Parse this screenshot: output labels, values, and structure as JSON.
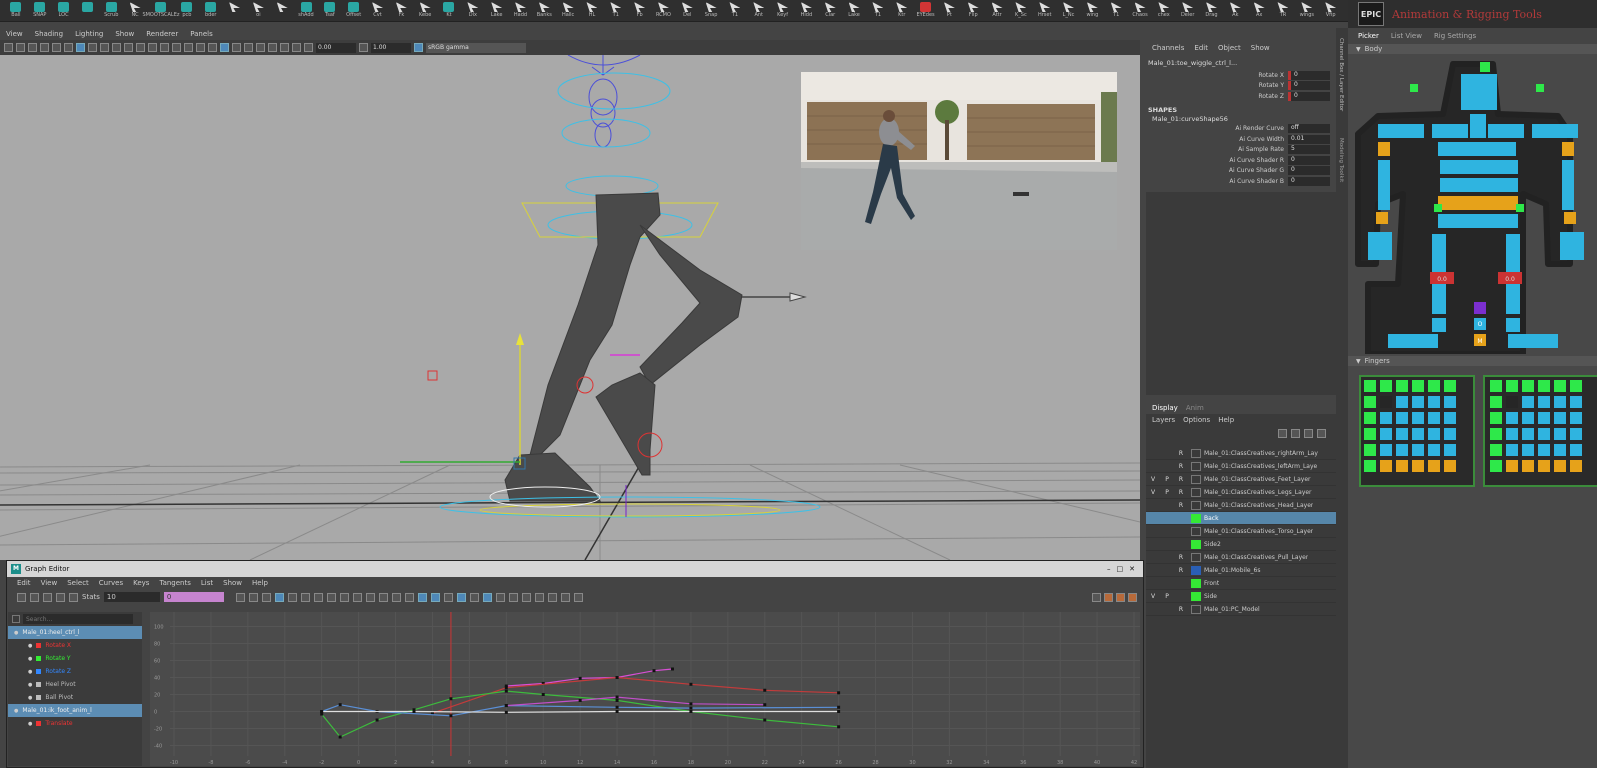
{
  "shelf": {
    "icons": [
      {
        "label": "Ball",
        "kind": "teal"
      },
      {
        "label": "SNAP",
        "kind": "teal"
      },
      {
        "label": "LOC",
        "kind": "teal"
      },
      {
        "label": "",
        "kind": "teal"
      },
      {
        "label": "Scrub",
        "kind": "teal"
      },
      {
        "label": "NC",
        "kind": "white"
      },
      {
        "label": "SMOOTSCALEz",
        "kind": "teal"
      },
      {
        "label": "pcb",
        "kind": "teal"
      },
      {
        "label": "bder",
        "kind": "teal"
      },
      {
        "label": "",
        "kind": "white"
      },
      {
        "label": "oi",
        "kind": "white"
      },
      {
        "label": "",
        "kind": "white"
      },
      {
        "label": "shAdd",
        "kind": "teal"
      },
      {
        "label": "Tsaf",
        "kind": "teal"
      },
      {
        "label": "Offset",
        "kind": "teal"
      },
      {
        "label": "Cvt",
        "kind": "white"
      },
      {
        "label": "Fk",
        "kind": "white"
      },
      {
        "label": "Kebe",
        "kind": "white"
      },
      {
        "label": "Kt",
        "kind": "teal"
      },
      {
        "label": "Dlx",
        "kind": "white"
      },
      {
        "label": "Lake",
        "kind": "white"
      },
      {
        "label": "Hadd",
        "kind": "white"
      },
      {
        "label": "Banks",
        "kind": "white"
      },
      {
        "label": "Hallc",
        "kind": "white"
      },
      {
        "label": "HL",
        "kind": "white"
      },
      {
        "label": "T1",
        "kind": "white"
      },
      {
        "label": "Fb",
        "kind": "white"
      },
      {
        "label": "RCMO",
        "kind": "white"
      },
      {
        "label": "Del",
        "kind": "white"
      },
      {
        "label": "Snap",
        "kind": "white"
      },
      {
        "label": "T1",
        "kind": "white"
      },
      {
        "label": "Ant",
        "kind": "white"
      },
      {
        "label": "Keyf",
        "kind": "white"
      },
      {
        "label": "Hldd",
        "kind": "white"
      },
      {
        "label": "Clar",
        "kind": "white"
      },
      {
        "label": "Lake",
        "kind": "white"
      },
      {
        "label": "T1",
        "kind": "white"
      },
      {
        "label": "Ktr",
        "kind": "white"
      },
      {
        "label": "EYEdes",
        "kind": "red"
      },
      {
        "label": "Pt",
        "kind": "white"
      },
      {
        "label": "Flip",
        "kind": "white"
      },
      {
        "label": "Attr",
        "kind": "white"
      },
      {
        "label": "K_Sc",
        "kind": "white"
      },
      {
        "label": "Hrset",
        "kind": "white"
      },
      {
        "label": "L_Nc",
        "kind": "white"
      },
      {
        "label": "wing",
        "kind": "white"
      },
      {
        "label": "T1",
        "kind": "white"
      },
      {
        "label": "Chaos",
        "kind": "white"
      },
      {
        "label": "chex",
        "kind": "white"
      },
      {
        "label": "Deler",
        "kind": "white"
      },
      {
        "label": "Drag",
        "kind": "white"
      },
      {
        "label": "Ak",
        "kind": "white"
      },
      {
        "label": "Ax",
        "kind": "white"
      },
      {
        "label": "TR",
        "kind": "white"
      },
      {
        "label": "wings",
        "kind": "white"
      },
      {
        "label": "Vfip",
        "kind": "white"
      },
      {
        "label": "",
        "kind": "white"
      }
    ]
  },
  "viewport": {
    "menu": [
      "View",
      "Shading",
      "Lighting",
      "Show",
      "Renderer",
      "Panels"
    ],
    "field_a": "0.00",
    "field_b": "1.00",
    "color_space": "sRGB gamma"
  },
  "channel_box": {
    "menu": [
      "Channels",
      "Edit",
      "Object",
      "Show"
    ],
    "node": "Male_01:toe_wiggle_ctrl_l...",
    "attrs": [
      {
        "label": "Rotate X",
        "value": "0"
      },
      {
        "label": "Rotate Y",
        "value": "0"
      },
      {
        "label": "Rotate Z",
        "value": "0"
      }
    ],
    "shapes_header": "SHAPES",
    "shape_node": "Male_01:curveShape56",
    "shape_attrs": [
      {
        "label": "Ai Render Curve",
        "value": "off"
      },
      {
        "label": "Ai Curve Width",
        "value": "0.01"
      },
      {
        "label": "Ai Sample Rate",
        "value": "5"
      },
      {
        "label": "Ai Curve Shader R",
        "value": "0"
      },
      {
        "label": "Ai Curve Shader G",
        "value": "0"
      },
      {
        "label": "Ai Curve Shader B",
        "value": "0"
      }
    ]
  },
  "layer_editor": {
    "tabs": [
      "Display",
      "Anim"
    ],
    "menu": [
      "Layers",
      "Options",
      "Help"
    ],
    "layers": [
      {
        "v": "",
        "p": "",
        "r": "R",
        "color": "",
        "name": "Male_01:ClassCreatives_rightArm_Lay",
        "sel": false
      },
      {
        "v": "",
        "p": "",
        "r": "R",
        "color": "",
        "name": "Male_01:ClassCreatives_leftArm_Laye",
        "sel": false
      },
      {
        "v": "V",
        "p": "P",
        "r": "R",
        "color": "",
        "name": "Male_01:ClassCreatives_Feet_Layer",
        "sel": false
      },
      {
        "v": "V",
        "p": "P",
        "r": "R",
        "color": "",
        "name": "Male_01:ClassCreatives_Legs_Layer",
        "sel": false
      },
      {
        "v": "",
        "p": "",
        "r": "R",
        "color": "",
        "name": "Male_01:ClassCreatives_Head_Layer",
        "sel": false
      },
      {
        "v": "",
        "p": "",
        "r": "",
        "color": "#35e835",
        "name": "Back",
        "sel": true
      },
      {
        "v": "",
        "p": "",
        "r": "",
        "color": "",
        "name": "Male_01:ClassCreatives_Torso_Layer",
        "sel": false
      },
      {
        "v": "",
        "p": "",
        "r": "",
        "color": "#35e835",
        "name": "Side2",
        "sel": false
      },
      {
        "v": "",
        "p": "",
        "r": "R",
        "color": "",
        "name": "Male_01:ClassCreatives_Pull_Layer",
        "sel": false
      },
      {
        "v": "",
        "p": "",
        "r": "R",
        "color": "#2a5fb5",
        "name": "Male_01:Mobile_6s",
        "sel": false
      },
      {
        "v": "",
        "p": "",
        "r": "",
        "color": "#35e835",
        "name": "Front",
        "sel": false
      },
      {
        "v": "V",
        "p": "P",
        "r": "",
        "color": "#35e835",
        "name": "Side",
        "sel": false
      },
      {
        "v": "",
        "p": "",
        "r": "R",
        "color": "",
        "name": "Male_01:PC_Model",
        "sel": false
      }
    ]
  },
  "side_tabs": [
    "Channel Box / Layer Editor",
    "Modeling Toolkit"
  ],
  "picker": {
    "logo": "EPIC",
    "title": "Animation & Rigging Tools",
    "tabs": [
      "Picker",
      "List View",
      "Rig Settings"
    ],
    "body_section": "Body",
    "fingers_section": "Fingers",
    "colors": {
      "blue": "#2fb4e0",
      "green": "#2ee84a",
      "orange": "#e6a21a",
      "purple": "#7b2fd0",
      "red": "#c33",
      "dark": "#262626"
    },
    "labels": {
      "hip_l": "0.0",
      "hip_r": "0.0",
      "mid": "M",
      "o": "O"
    }
  },
  "graph_editor": {
    "title": "Graph Editor",
    "menu": [
      "Edit",
      "View",
      "Select",
      "Curves",
      "Keys",
      "Tangents",
      "List",
      "Show",
      "Help"
    ],
    "stats_label": "Stats",
    "stats_value": "10",
    "frame_value": "0",
    "search_placeholder": "Search...",
    "outliner": [
      {
        "label": "Male_01:heel_ctrl_l",
        "color": "",
        "sel": true,
        "indent": 0
      },
      {
        "label": "Rotate X",
        "color": "#e33",
        "sel": false,
        "indent": 1
      },
      {
        "label": "Rotate Y",
        "color": "#3e3",
        "sel": false,
        "indent": 1
      },
      {
        "label": "Rotate Z",
        "color": "#38f",
        "sel": false,
        "indent": 1
      },
      {
        "label": "Heel Pivot",
        "color": "#bbb",
        "sel": false,
        "indent": 1
      },
      {
        "label": "Ball Pivot",
        "color": "#bbb",
        "sel": false,
        "indent": 1
      },
      {
        "label": "Male_01:ik_foot_anim_l",
        "color": "",
        "sel": true,
        "indent": 0
      },
      {
        "label": "Translate",
        "color": "#e33",
        "sel": false,
        "indent": 1
      }
    ],
    "y_ticks": [
      "100",
      "80",
      "60",
      "40",
      "20",
      "0",
      "-20",
      "-40"
    ],
    "x_ticks": [
      "-10",
      "-8",
      "-6",
      "-4",
      "-2",
      "0",
      "2",
      "4",
      "6",
      "8",
      "10",
      "12",
      "14",
      "16",
      "18",
      "20",
      "22",
      "24",
      "26",
      "28",
      "30",
      "32",
      "34",
      "36",
      "38",
      "40",
      "42"
    ],
    "current_frame": 5,
    "curves": [
      {
        "name": "pink",
        "color": "#d94fd6",
        "points": [
          [
            8,
            30
          ],
          [
            10,
            33
          ],
          [
            12,
            39
          ],
          [
            14,
            40
          ],
          [
            16,
            48
          ],
          [
            17,
            50
          ]
        ]
      },
      {
        "name": "red",
        "color": "#c43b3b",
        "points": [
          [
            4,
            -2
          ],
          [
            8,
            28
          ],
          [
            14,
            40
          ],
          [
            18,
            32
          ],
          [
            22,
            25
          ],
          [
            26,
            22
          ]
        ]
      },
      {
        "name": "green",
        "color": "#3dbb3d",
        "points": [
          [
            -2,
            -3
          ],
          [
            -1,
            -30
          ],
          [
            1,
            -10
          ],
          [
            3,
            2
          ],
          [
            5,
            15
          ],
          [
            8,
            24
          ],
          [
            10,
            20
          ],
          [
            14,
            13
          ],
          [
            18,
            0
          ],
          [
            22,
            -10
          ],
          [
            26,
            -18
          ]
        ]
      },
      {
        "name": "blue",
        "color": "#5a8fd6",
        "points": [
          [
            -2,
            0
          ],
          [
            -1,
            8
          ],
          [
            1,
            0
          ],
          [
            5,
            -5
          ],
          [
            8,
            7
          ],
          [
            14,
            5
          ],
          [
            18,
            4
          ],
          [
            26,
            5
          ]
        ]
      },
      {
        "name": "magenta2",
        "color": "#c04fc9",
        "points": [
          [
            8,
            7
          ],
          [
            12,
            13
          ],
          [
            14,
            17
          ],
          [
            18,
            9
          ],
          [
            22,
            8
          ]
        ]
      },
      {
        "name": "white",
        "color": "#e0e0e0",
        "points": [
          [
            -2,
            0
          ],
          [
            3,
            0
          ],
          [
            8,
            -1
          ],
          [
            14,
            0
          ],
          [
            18,
            0
          ],
          [
            26,
            0
          ]
        ]
      }
    ]
  }
}
